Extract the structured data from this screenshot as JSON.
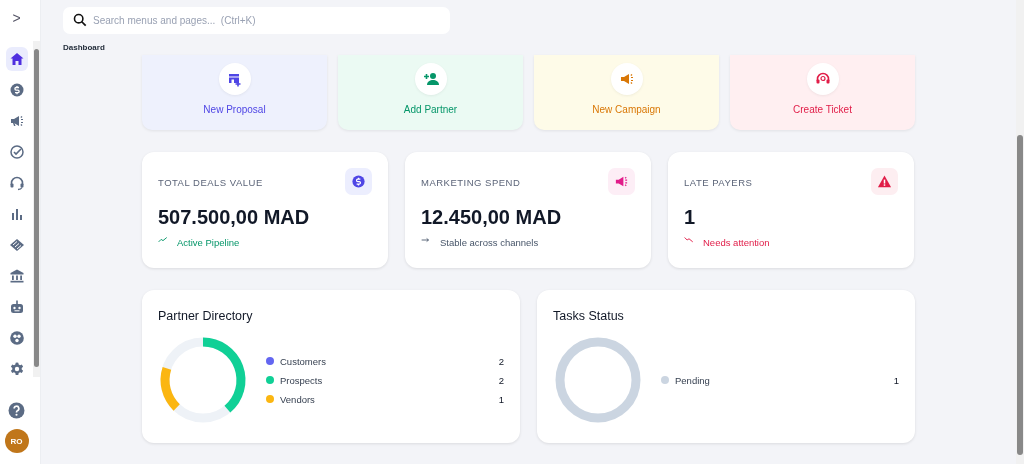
{
  "sidebar": {
    "toggle": ">",
    "items": [
      {
        "selected": true
      },
      {
        "selected": false
      },
      {
        "selected": false
      },
      {
        "selected": false
      },
      {
        "selected": false
      },
      {
        "selected": false
      },
      {
        "selected": false
      },
      {
        "selected": false
      },
      {
        "selected": false
      },
      {
        "selected": false
      },
      {
        "selected": false
      }
    ],
    "avatar": "RO"
  },
  "search": {
    "placeholder": "Search menus and pages...  (Ctrl+K)"
  },
  "breadcrumb": "Dashboard",
  "quick_actions": [
    {
      "label": "New Proposal",
      "color": "#4f46e5"
    },
    {
      "label": "Add Partner",
      "color": "#059669"
    },
    {
      "label": "New Campaign",
      "color": "#d97706"
    },
    {
      "label": "Create Ticket",
      "color": "#e11d48"
    }
  ],
  "stats": [
    {
      "label": "TOTAL DEALS VALUE",
      "value": "507.500,00 MAD",
      "trend": "Active Pipeline",
      "kind": "up"
    },
    {
      "label": "MARKETING SPEND",
      "value": "12.450,00 MAD",
      "trend": "Stable across channels",
      "kind": "flat"
    },
    {
      "label": "LATE PAYERS",
      "value": "1",
      "trend": "Needs attention",
      "kind": "down"
    }
  ],
  "partner_directory": {
    "title": "Partner Directory",
    "legend": [
      {
        "label": "Customers",
        "count": "2",
        "color": "#6366f1"
      },
      {
        "label": "Prospects",
        "count": "2",
        "color": "#10d096"
      },
      {
        "label": "Vendors",
        "count": "1",
        "color": "#fbb611"
      }
    ]
  },
  "tasks_status": {
    "title": "Tasks Status",
    "legend": [
      {
        "label": "Pending",
        "count": "1",
        "color": "#cbd5e1"
      }
    ]
  }
}
